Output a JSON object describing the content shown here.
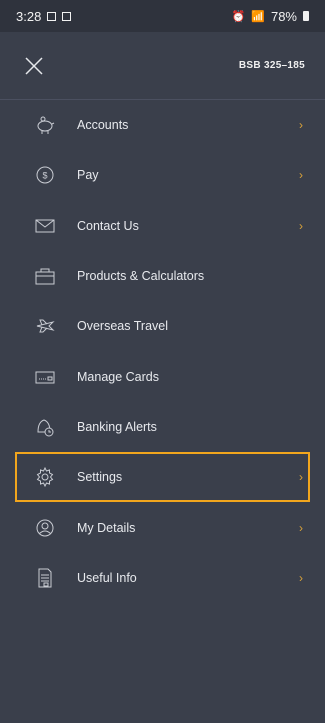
{
  "status": {
    "time": "3:28",
    "battery": "78%"
  },
  "header": {
    "bsb": "BSB 325–185"
  },
  "menu": [
    {
      "label": "Accounts",
      "icon": "piggy-bank-icon",
      "chevron": true
    },
    {
      "label": "Pay",
      "icon": "dollar-circle-icon",
      "chevron": true
    },
    {
      "label": "Contact Us",
      "icon": "envelope-icon",
      "chevron": true
    },
    {
      "label": "Products & Calculators",
      "icon": "briefcase-icon",
      "chevron": false
    },
    {
      "label": "Overseas Travel",
      "icon": "airplane-icon",
      "chevron": false
    },
    {
      "label": "Manage Cards",
      "icon": "card-icon",
      "chevron": false
    },
    {
      "label": "Banking Alerts",
      "icon": "bell-clock-icon",
      "chevron": false
    },
    {
      "label": "Settings",
      "icon": "gear-icon",
      "chevron": true,
      "selected": true
    },
    {
      "label": "My Details",
      "icon": "user-circle-icon",
      "chevron": true
    },
    {
      "label": "Useful Info",
      "icon": "document-icon",
      "chevron": true
    }
  ],
  "colors": {
    "background": "#3a3f4b",
    "accent": "#d9a23a",
    "highlight": "#f2a61d"
  }
}
